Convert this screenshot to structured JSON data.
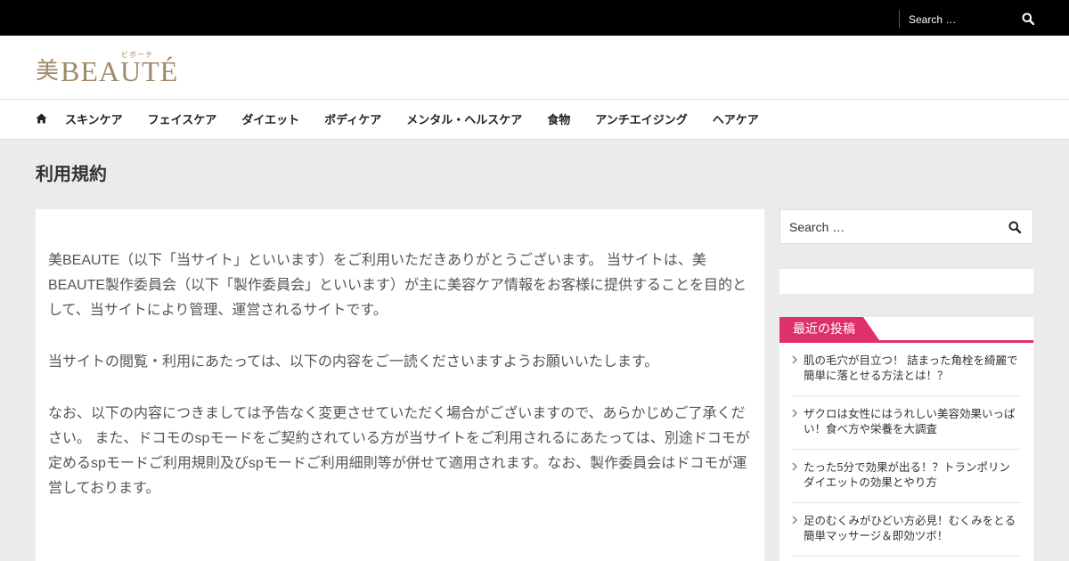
{
  "topbar": {
    "search_placeholder": "Search …",
    "search_icon": "search-icon"
  },
  "header": {
    "logo_kanji": "美",
    "logo_word": "BEAUTÉ",
    "logo_ruby": "ビボーテ"
  },
  "nav": {
    "home_icon": "home-icon",
    "items": [
      {
        "label": "スキンケア"
      },
      {
        "label": "フェイスケア"
      },
      {
        "label": "ダイエット"
      },
      {
        "label": "ボディケア"
      },
      {
        "label": "メンタル・ヘルスケア"
      },
      {
        "label": "食物"
      },
      {
        "label": "アンチエイジング"
      },
      {
        "label": "ヘアケア"
      }
    ]
  },
  "page": {
    "title": "利用規約",
    "paragraphs": [
      "美BEAUTE（以下「当サイト」といいます）をご利用いただきありがとうございます。 当サイトは、美BEAUTE製作委員会（以下「製作委員会」といいます）が主に美容ケア情報をお客様に提供することを目的として、当サイトにより管理、運営されるサイトです。",
      "当サイトの閲覧・利用にあたっては、以下の内容をご一読くださいますようお願いいたします。",
      "なお、以下の内容につきましては予告なく変更させていただく場合がございますので、あらかじめご了承ください。 また、ドコモのspモードをご契約されている方が当サイトをご利用されるにあたっては、別途ドコモが定めるspモードご利用規則及びspモードご利用細則等が併せて適用されます。なお、製作委員会はドコモが運営しております。"
    ]
  },
  "sidebar": {
    "search_placeholder": "Search …",
    "recent_title": "最近の投稿",
    "recent_posts": [
      {
        "title": "肌の毛穴が目立つ！ 詰まった角栓を綺麗で簡単に落とせる方法とは！？"
      },
      {
        "title": "ザクロは女性にはうれしい美容効果いっぱい！食べ方や栄養を大調査"
      },
      {
        "title": "たった5分で効果が出る！？トランポリンダイエットの効果とやり方"
      },
      {
        "title": "足のむくみがひどい方必見！むくみをとる簡単マッサージ＆即効ツボ！"
      }
    ]
  },
  "colors": {
    "accent": "#e0306a",
    "logo": "#a0896a",
    "topbar": "#000000",
    "background": "#ebebeb"
  }
}
